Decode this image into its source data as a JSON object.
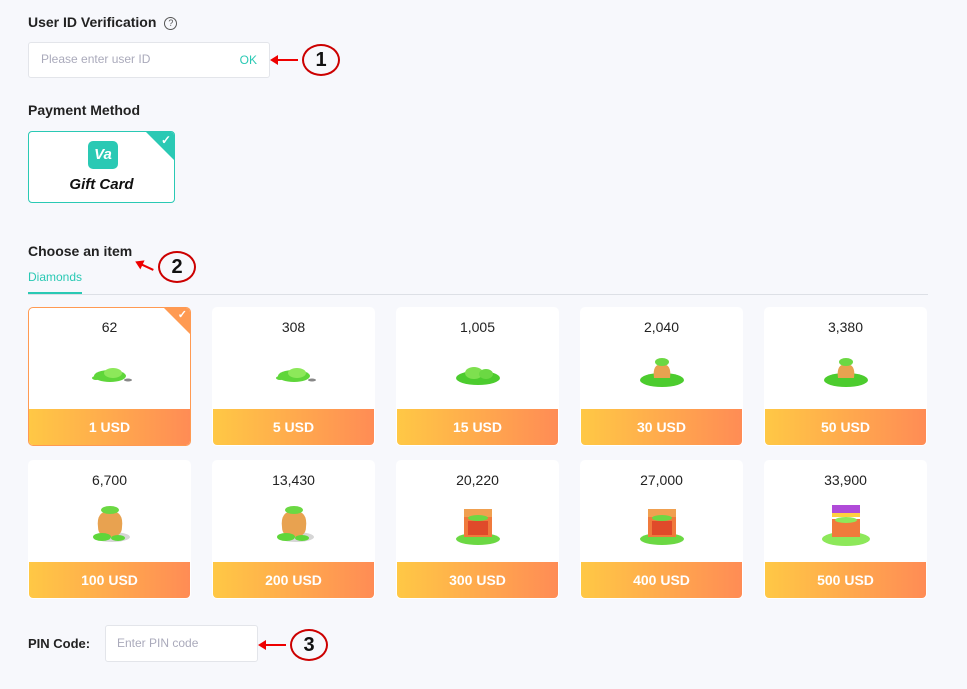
{
  "user_id": {
    "title": "User ID Verification",
    "help_icon": "?",
    "placeholder": "Please enter user ID",
    "value": "",
    "ok_label": "OK"
  },
  "payment": {
    "title": "Payment Method",
    "method_label": "Gift Card",
    "logo_text": "Va",
    "selected": true,
    "check": "✓"
  },
  "items_section": {
    "title": "Choose an item",
    "tabs": [
      {
        "label": "Diamonds",
        "active": true
      }
    ],
    "items": [
      {
        "amount": "62",
        "price": "1 USD",
        "icon": "small-gem-pile",
        "selected": true
      },
      {
        "amount": "308",
        "price": "5 USD",
        "icon": "small-gem-pile"
      },
      {
        "amount": "1,005",
        "price": "15 USD",
        "icon": "gem-pile"
      },
      {
        "amount": "2,040",
        "price": "30 USD",
        "icon": "gem-bag-small"
      },
      {
        "amount": "3,380",
        "price": "50 USD",
        "icon": "gem-bag-small"
      },
      {
        "amount": "6,700",
        "price": "100 USD",
        "icon": "gem-pot"
      },
      {
        "amount": "13,430",
        "price": "200 USD",
        "icon": "gem-pot"
      },
      {
        "amount": "20,220",
        "price": "300 USD",
        "icon": "gem-chest"
      },
      {
        "amount": "27,000",
        "price": "400 USD",
        "icon": "gem-chest"
      },
      {
        "amount": "33,900",
        "price": "500 USD",
        "icon": "gem-treasure-chest"
      }
    ],
    "check": "✓"
  },
  "pin": {
    "label": "PIN Code:",
    "placeholder": "Enter PIN code",
    "value": ""
  },
  "annotations": [
    "1",
    "2",
    "3"
  ],
  "colors": {
    "accent": "#2ac9b4",
    "price_gradient_start": "#ffc845",
    "price_gradient_end": "#ff8c55",
    "selected_border": "#ff9a52",
    "annotation": "#e00000"
  }
}
